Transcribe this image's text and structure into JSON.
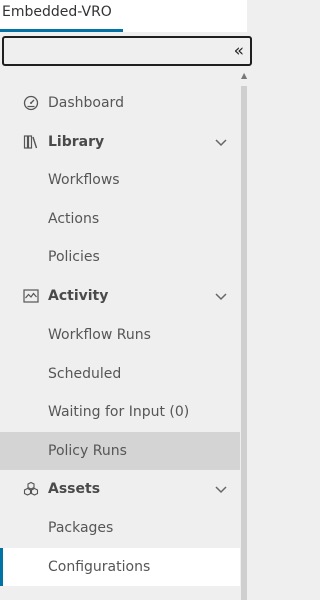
{
  "header": {
    "app_tab_label": "Embedded-VRO"
  },
  "sidebar": {
    "collapse_icon": "double-chevron-left-icon",
    "collapse_glyph": "«",
    "items": [
      {
        "label": "Dashboard",
        "icon": "dashboard-icon"
      },
      {
        "label": "Library",
        "icon": "library-icon",
        "expanded": true
      },
      {
        "label": "Workflows"
      },
      {
        "label": "Actions"
      },
      {
        "label": "Policies"
      },
      {
        "label": "Activity",
        "icon": "activity-icon",
        "expanded": true
      },
      {
        "label": "Workflow Runs"
      },
      {
        "label": "Scheduled"
      },
      {
        "label": "Waiting for Input (0)"
      },
      {
        "label": "Policy Runs",
        "state": "highlighted"
      },
      {
        "label": "Assets",
        "icon": "assets-icon",
        "expanded": true
      },
      {
        "label": "Packages"
      },
      {
        "label": "Configurations",
        "state": "active"
      }
    ]
  },
  "colors": {
    "accent": "#0072a3",
    "nav_bg": "#efefef",
    "highlight_bg": "#d4d4d4"
  }
}
